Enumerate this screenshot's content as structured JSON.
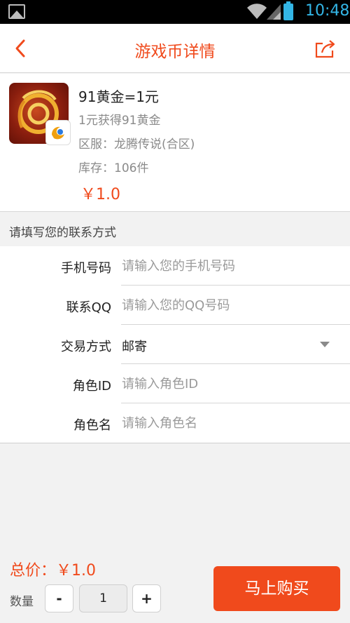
{
  "status_bar": {
    "time": "10:48"
  },
  "header": {
    "title": "游戏币详情"
  },
  "product": {
    "name": "91黄金=1元",
    "subtitle": "1元获得91黄金",
    "server": "区服：龙腾传说(合区)",
    "stock": "库存：106件",
    "price": "￥1.0"
  },
  "contact_section": {
    "title": "请填写您的联系方式"
  },
  "form": {
    "phone": {
      "label": "手机号码",
      "placeholder": "请输入您的手机号码"
    },
    "qq": {
      "label": "联系QQ",
      "placeholder": "请输入您的QQ号码"
    },
    "trade_method": {
      "label": "交易方式",
      "value": "邮寄"
    },
    "role_id": {
      "label": "角色ID",
      "placeholder": "请输入角色ID"
    },
    "role_name": {
      "label": "角色名",
      "placeholder": "请输入角色名"
    }
  },
  "footer": {
    "total": "总价：￥1.0",
    "quantity_label": "数量",
    "minus": "-",
    "quantity": "1",
    "plus": "+",
    "buy_label": "马上购买"
  },
  "colors": {
    "accent": "#f04a1c",
    "status_blue": "#33b5e5"
  },
  "icons": [
    "image-icon",
    "wifi-icon",
    "signal-icon",
    "battery-icon",
    "back-arrow-icon",
    "share-icon",
    "game-logo",
    "dropdown-arrow-icon"
  ]
}
